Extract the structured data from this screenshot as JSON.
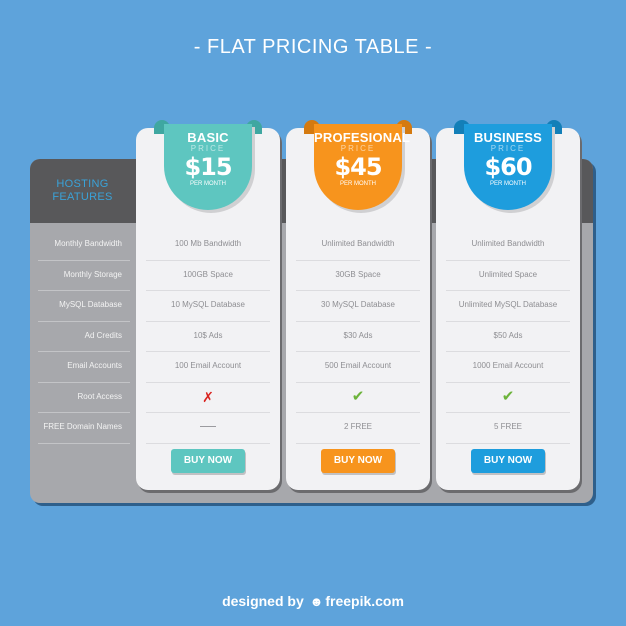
{
  "header": {
    "title": "- FLAT PRICING TABLE -"
  },
  "features_panel": {
    "heading_line1": "HOSTING",
    "heading_line2": "FEATURES",
    "heading_color": "#3aa2d8",
    "items": [
      "Monthly Bandwidth",
      "Monthly Storage",
      "MySQL Database",
      "Ad Credits",
      "Email Accounts",
      "Root Access",
      "FREE Domain Names"
    ]
  },
  "plans": [
    {
      "name": "BASIC",
      "price_label": "PRICE",
      "price": "$15",
      "period": "PER MONTH",
      "color": "#5ec6c0",
      "dark": "#3fa7a1",
      "features": [
        "100 Mb Bandwidth",
        "100GB Space",
        "10 MySQL Database",
        "10$ Ads",
        "100 Email Account"
      ],
      "root_access": "x-icon",
      "domains": "—",
      "button": "BUY NOW"
    },
    {
      "name": "PROFESIONAL",
      "price_label": "PRICE",
      "price": "$45",
      "period": "PER MONTH",
      "color": "#f7941d",
      "dark": "#d47a10",
      "features": [
        "Unlimited Bandwidth",
        "30GB Space",
        "30 MySQL Database",
        "$30 Ads",
        "500 Email Account"
      ],
      "root_access": "check-icon",
      "domains": "2 FREE",
      "button": "BUY NOW"
    },
    {
      "name": "BUSINESS",
      "price_label": "PRICE",
      "price": "$60",
      "period": "PER MONTH",
      "color": "#1e9ddd",
      "dark": "#137fb8",
      "features": [
        "Unlimited Bandwidth",
        "Unlimited Space",
        "Unlimited MySQL Database",
        "$50 Ads",
        "1000 Email Account"
      ],
      "root_access": "check-icon",
      "domains": "5 FREE",
      "button": "BUY NOW"
    }
  ],
  "icons": {
    "x": "✗",
    "check": "✔"
  },
  "footer": {
    "prefix": "designed by",
    "brand": "freepik.com",
    "logo_icon": "freepik-logo-icon"
  }
}
